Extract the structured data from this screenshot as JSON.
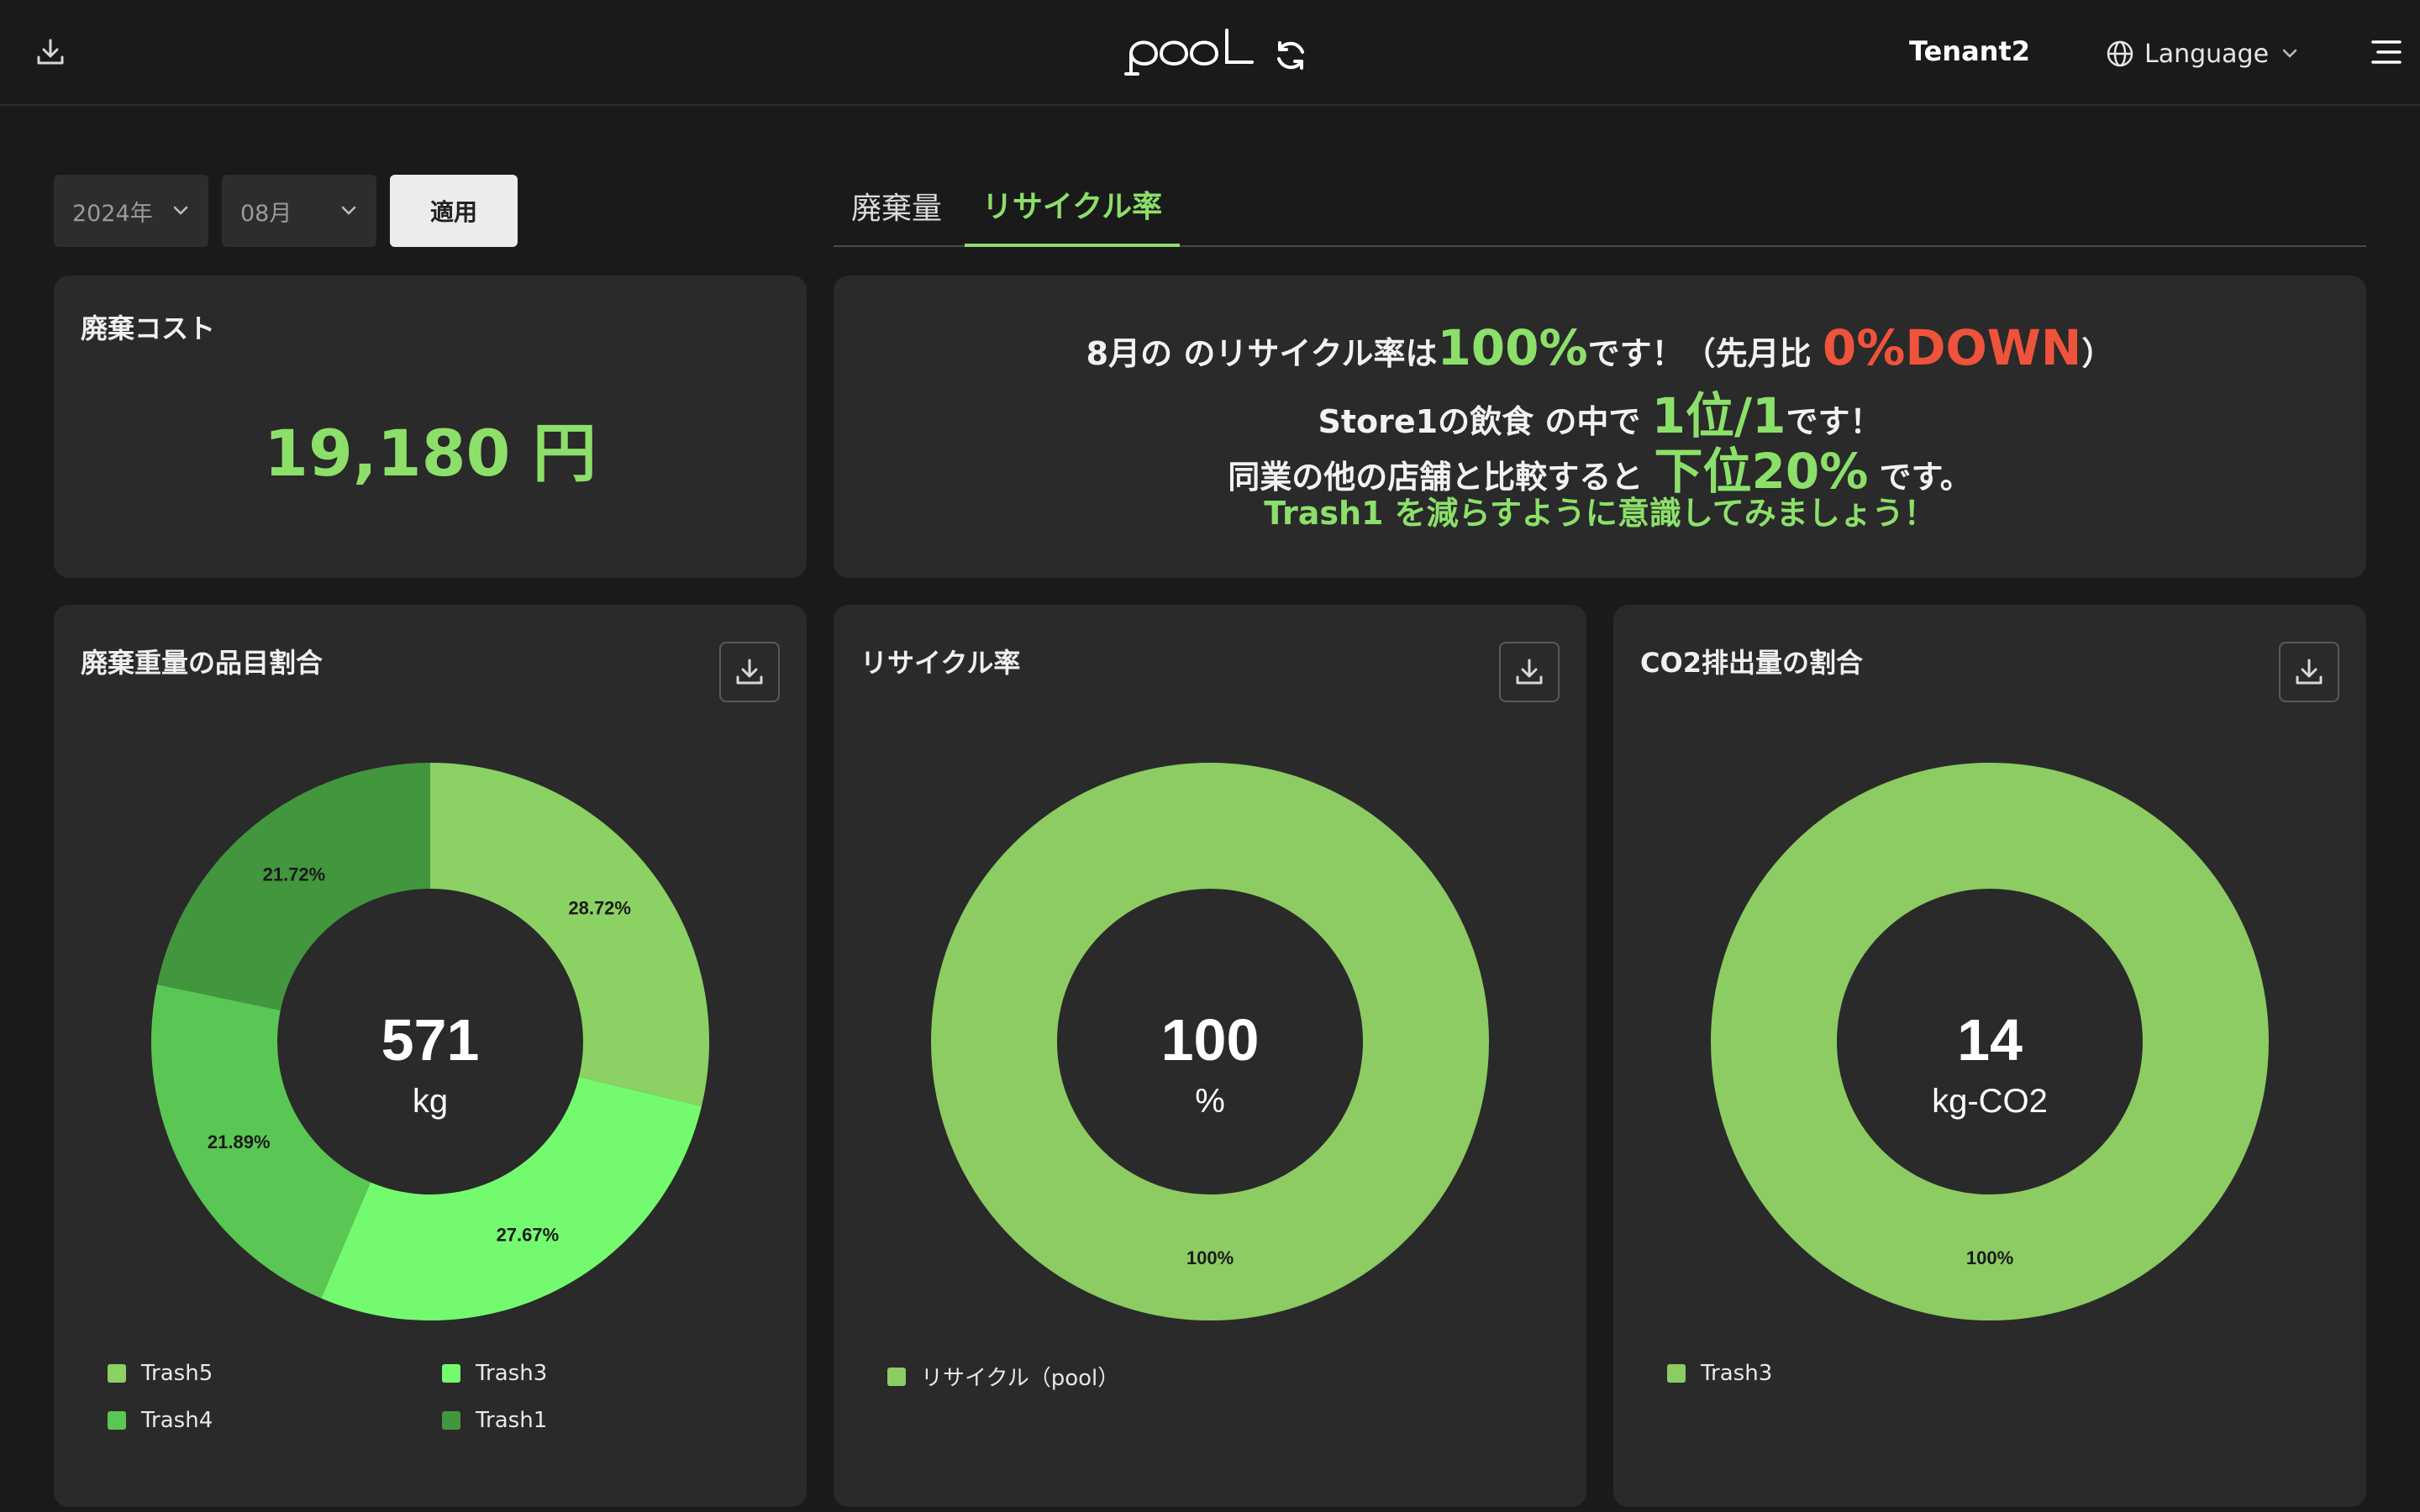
{
  "header": {
    "logo_text": "pool",
    "tenant": "Tenant2",
    "language_label": "Language"
  },
  "filters": {
    "year": "2024年",
    "month": "08月",
    "apply_label": "適用"
  },
  "tabs": [
    {
      "label": "廃棄量",
      "active": false
    },
    {
      "label": "リサイクル率",
      "active": true
    }
  ],
  "cost": {
    "title": "廃棄コスト",
    "value": "19,180 円"
  },
  "message": {
    "line1_a": "8月の のリサイクル率は",
    "line1_hl": "100%",
    "line1_b": "です！（先月比 ",
    "line1_red": "0%DOWN",
    "line1_c": "）",
    "line2_a": "Store1の飲食 の中で ",
    "line2_hl": "1位/1",
    "line2_b": "です！",
    "line3_a": "同業の他の店舗と比較すると ",
    "line3_hl": "下位20%",
    "line3_b": " です。",
    "line4": "Trash1 を減らすように意識してみましょう！"
  },
  "colors": {
    "accent": "#8ce06a",
    "red": "#f0533b",
    "trash5": "#8bd163",
    "trash3": "#74fa6e",
    "trash4": "#5ac754",
    "trash1": "#42963d"
  },
  "chart_data": [
    {
      "type": "pie",
      "title": "廃棄重量の品目割合",
      "center_value": "571",
      "center_unit": "kg",
      "categories": [
        "Trash5",
        "Trash3",
        "Trash4",
        "Trash1"
      ],
      "values": [
        28.72,
        27.67,
        21.89,
        21.72
      ],
      "labels": [
        "28.72%",
        "27.67%",
        "21.89%",
        "21.72%"
      ],
      "colors": [
        "#8bd163",
        "#74fa6e",
        "#5ac754",
        "#42963d"
      ],
      "legend": "bottom"
    },
    {
      "type": "pie",
      "title": "リサイクル率",
      "center_value": "100",
      "center_unit": "%",
      "categories": [
        "リサイクル（pool）"
      ],
      "values": [
        100
      ],
      "labels": [
        "100%"
      ],
      "colors": [
        "#8ccc63"
      ],
      "legend": "bottom"
    },
    {
      "type": "pie",
      "title": "CO2排出量の割合",
      "center_value": "14",
      "center_unit": "kg-CO2",
      "categories": [
        "Trash3"
      ],
      "values": [
        100
      ],
      "labels": [
        "100%"
      ],
      "colors": [
        "#8ccc63"
      ],
      "legend": "bottom"
    }
  ]
}
